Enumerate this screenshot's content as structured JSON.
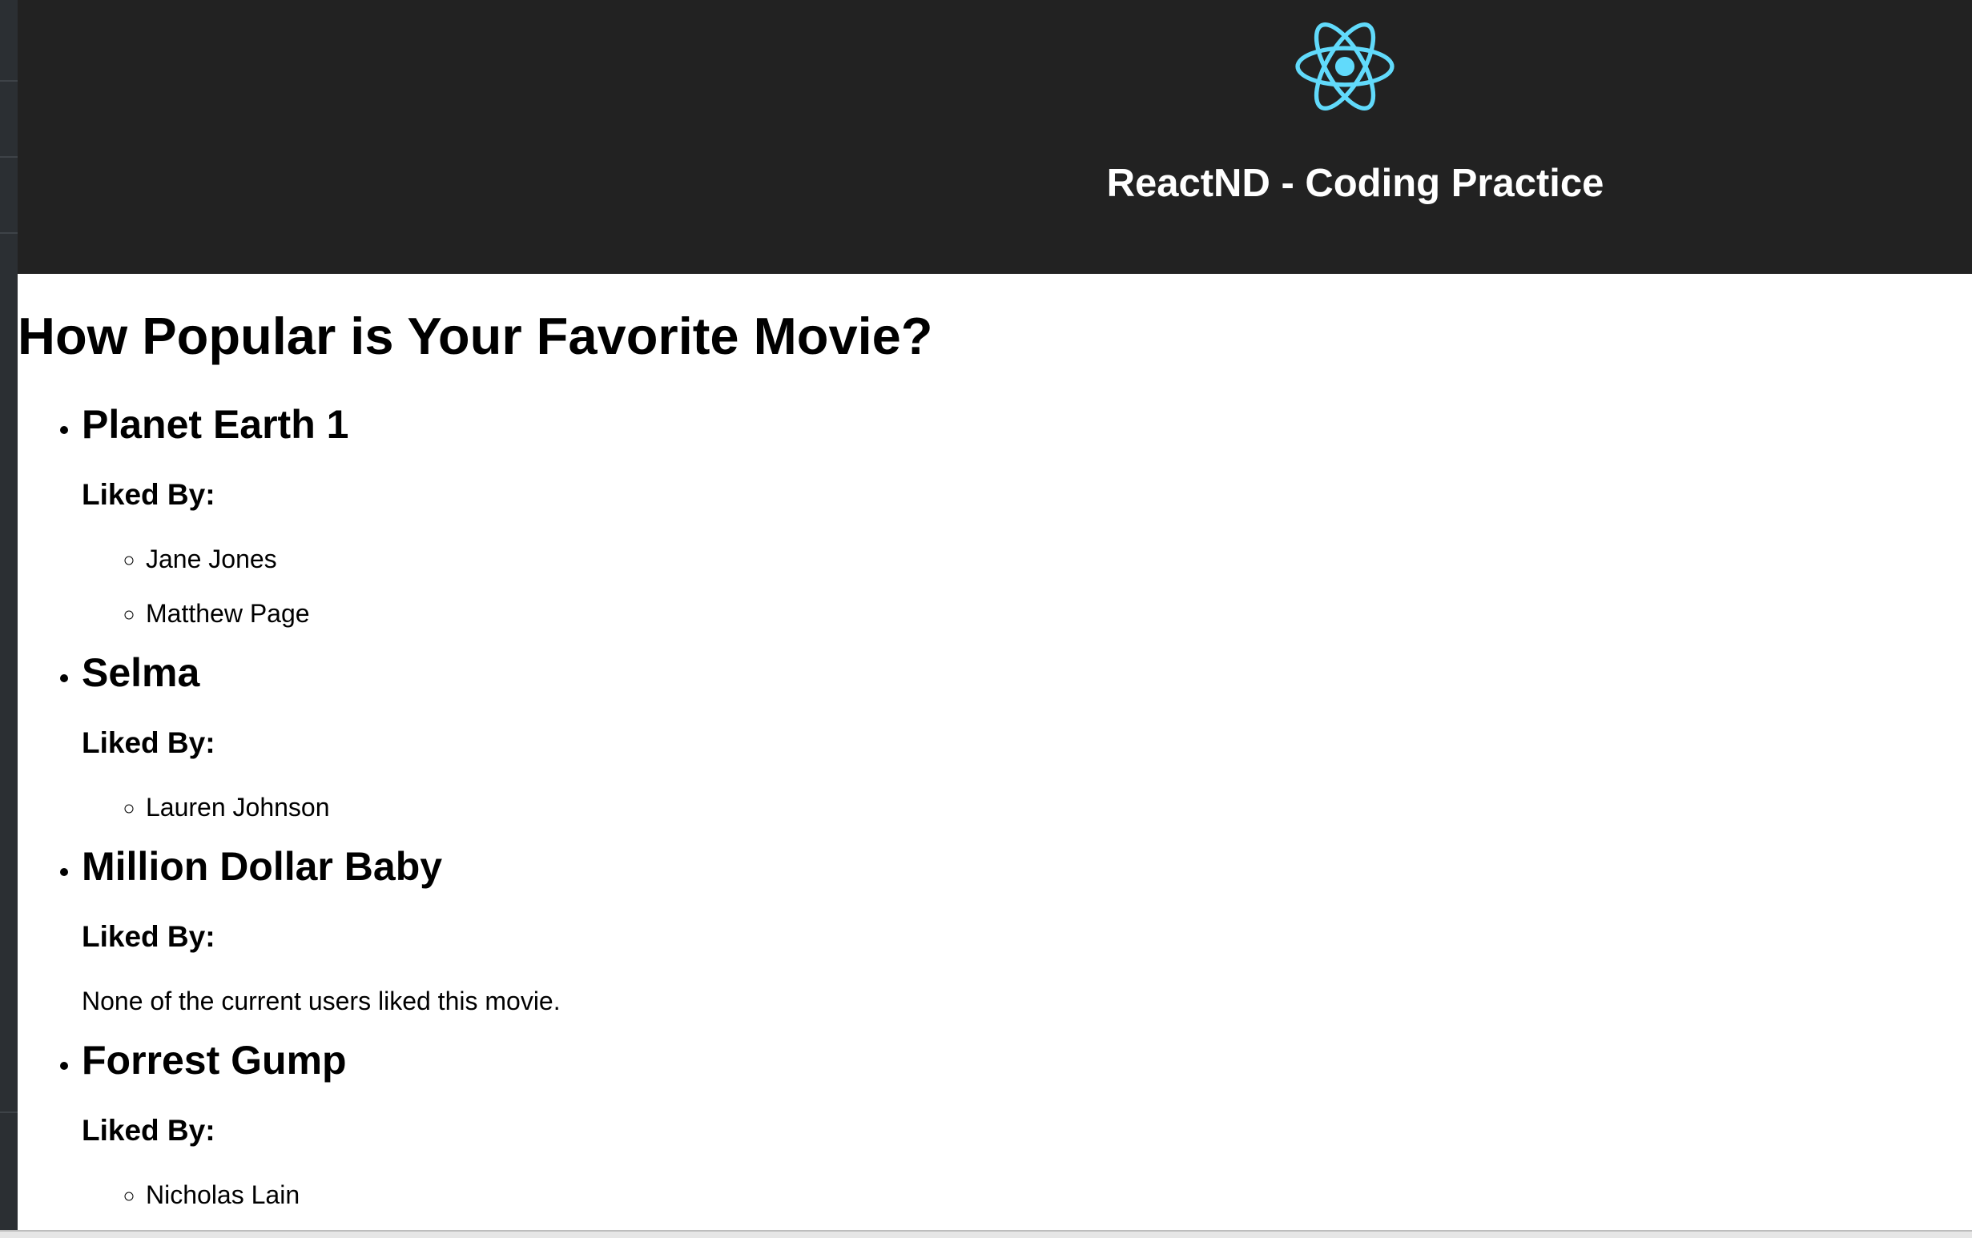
{
  "header": {
    "logo_icon": "react-atom-icon",
    "logo_color": "#61dafb",
    "title": "ReactND - Coding Practice",
    "background": "#222222"
  },
  "main": {
    "heading": "How Popular is Your Favorite Movie?",
    "liked_by_label": "Liked By:",
    "movies": [
      {
        "title": "Planet Earth 1",
        "liked_by_label": "Liked By:",
        "fans": [
          "Jane Jones",
          "Matthew Page"
        ],
        "empty_message": ""
      },
      {
        "title": "Selma",
        "liked_by_label": "Liked By:",
        "fans": [
          "Lauren Johnson"
        ],
        "empty_message": ""
      },
      {
        "title": "Million Dollar Baby",
        "liked_by_label": "Liked By:",
        "fans": [],
        "empty_message": "None of the current users liked this movie."
      },
      {
        "title": "Forrest Gump",
        "liked_by_label": "Liked By:",
        "fans": [
          "Nicholas Lain"
        ],
        "empty_message": ""
      }
    ]
  }
}
